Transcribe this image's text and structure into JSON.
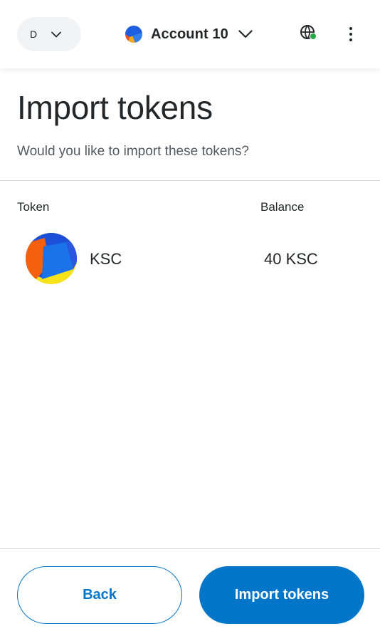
{
  "header": {
    "network_label": "D",
    "account_name": "Account 10",
    "connection_status_color": "#28a745"
  },
  "main": {
    "title": "Import tokens",
    "subtitle": "Would you like to import these tokens?",
    "columns": {
      "token": "Token",
      "balance": "Balance"
    },
    "tokens": [
      {
        "symbol": "KSC",
        "balance": "40 KSC",
        "icon": "ksc-token-icon"
      }
    ]
  },
  "footer": {
    "back_label": "Back",
    "import_label": "Import tokens"
  },
  "colors": {
    "primary": "#0376c9",
    "text": "#24272a",
    "muted": "#535a61",
    "divider": "#d6d9dc"
  }
}
